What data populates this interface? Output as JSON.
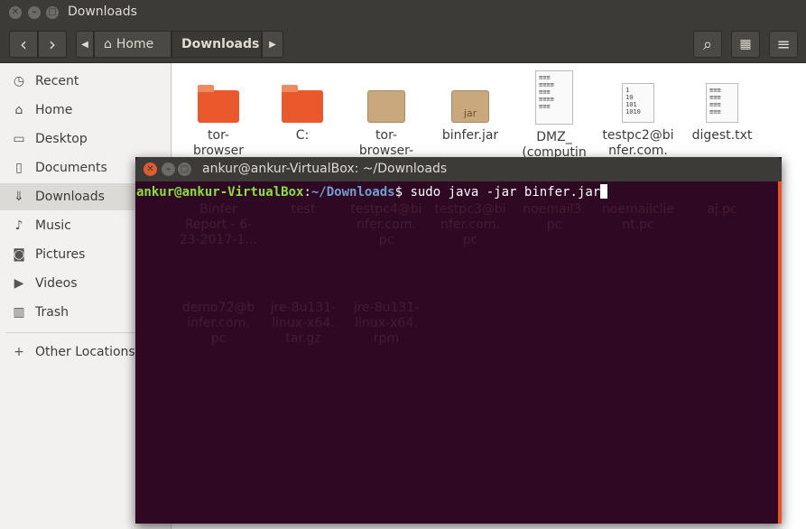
{
  "window": {
    "title": "Downloads"
  },
  "toolbar": {
    "back_icon": "‹",
    "forward_icon": "›",
    "crumb_home": "Home",
    "crumb_downloads": "Downloads",
    "search_icon": "⌕",
    "view_icon": "▦",
    "menu_icon": "≡"
  },
  "sidebar": {
    "items": [
      {
        "label": "Recent",
        "icon": "◷"
      },
      {
        "label": "Home",
        "icon": "⌂"
      },
      {
        "label": "Desktop",
        "icon": "▭"
      },
      {
        "label": "Documents",
        "icon": "▯"
      },
      {
        "label": "Downloads",
        "icon": "⇓"
      },
      {
        "label": "Music",
        "icon": "♪"
      },
      {
        "label": "Pictures",
        "icon": "◙"
      },
      {
        "label": "Videos",
        "icon": "▶"
      },
      {
        "label": "Trash",
        "icon": "▥"
      },
      {
        "label": "Other Locations",
        "icon": "+"
      }
    ]
  },
  "files": [
    {
      "name": "tor-\nbrowser",
      "type": "folder"
    },
    {
      "name": "C:",
      "type": "folder"
    },
    {
      "name": "tor-\nbrowser-",
      "type": "archive"
    },
    {
      "name": "binfer.jar",
      "type": "jar"
    },
    {
      "name": "DMZ_\n(computin",
      "type": "document"
    },
    {
      "name": "testpc2@bi\nnfer.com.",
      "type": "binary"
    },
    {
      "name": "digest.txt",
      "type": "text"
    }
  ],
  "ghost_files": [
    "Binfer\nReport - 6-\n23-2017-1…",
    "test",
    "testpc4@bi\nnfer.com.\npc",
    "testpc3@bi\nnfer.com.\npc",
    "noemail3.\npc",
    "noemailclie\nnt.pc",
    "aj.pc",
    "demo72@b\ninfer.com.\npc",
    "jre-8u131-\nlinux-x64.\ntar.gz",
    "jre-8u131-\nlinux-x64.\nrpm"
  ],
  "terminal": {
    "title": "ankur@ankur-VirtualBox: ~/Downloads",
    "prompt_user": "ankur@ankur-VirtualBox",
    "prompt_sep": ":",
    "prompt_path": "~/Downloads",
    "prompt_dollar": "$ ",
    "command": "sudo java -jar binfer.jar"
  },
  "colors": {
    "accent": "#e95420",
    "terminal_bg": "#300a24",
    "folder": "#e9592c"
  }
}
